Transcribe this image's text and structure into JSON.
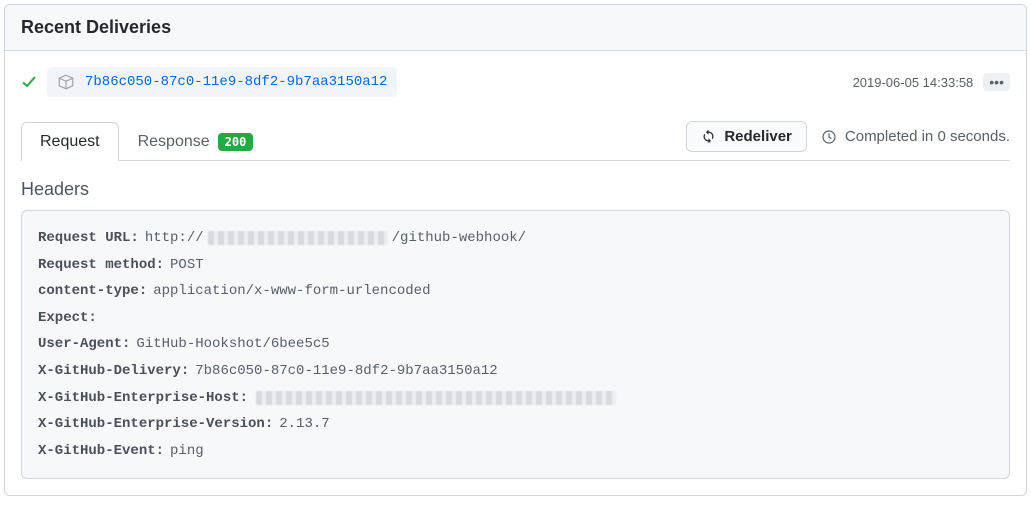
{
  "panel": {
    "title": "Recent Deliveries"
  },
  "delivery": {
    "id": "7b86c050-87c0-11e9-8df2-9b7aa3150a12",
    "timestamp": "2019-06-05 14:33:58"
  },
  "tabs": {
    "request_label": "Request",
    "response_label": "Response",
    "response_status": "200"
  },
  "actions": {
    "redeliver_label": "Redeliver",
    "completed_text": "Completed in 0 seconds."
  },
  "headers_section": {
    "title": "Headers"
  },
  "headers": {
    "request_url_key": "Request URL:",
    "request_url_prefix": "http://",
    "request_url_suffix": "/github-webhook/",
    "request_method_key": "Request method:",
    "request_method_val": "POST",
    "content_type_key": "content-type:",
    "content_type_val": "application/x-www-form-urlencoded",
    "expect_key": "Expect:",
    "expect_val": "",
    "user_agent_key": "User-Agent:",
    "user_agent_val": "GitHub-Hookshot/6bee5c5",
    "delivery_key": "X-GitHub-Delivery:",
    "delivery_val": "7b86c050-87c0-11e9-8df2-9b7aa3150a12",
    "ent_host_key": "X-GitHub-Enterprise-Host:",
    "ent_version_key": "X-GitHub-Enterprise-Version:",
    "ent_version_val": "2.13.7",
    "event_key": "X-GitHub-Event:",
    "event_val": "ping"
  }
}
